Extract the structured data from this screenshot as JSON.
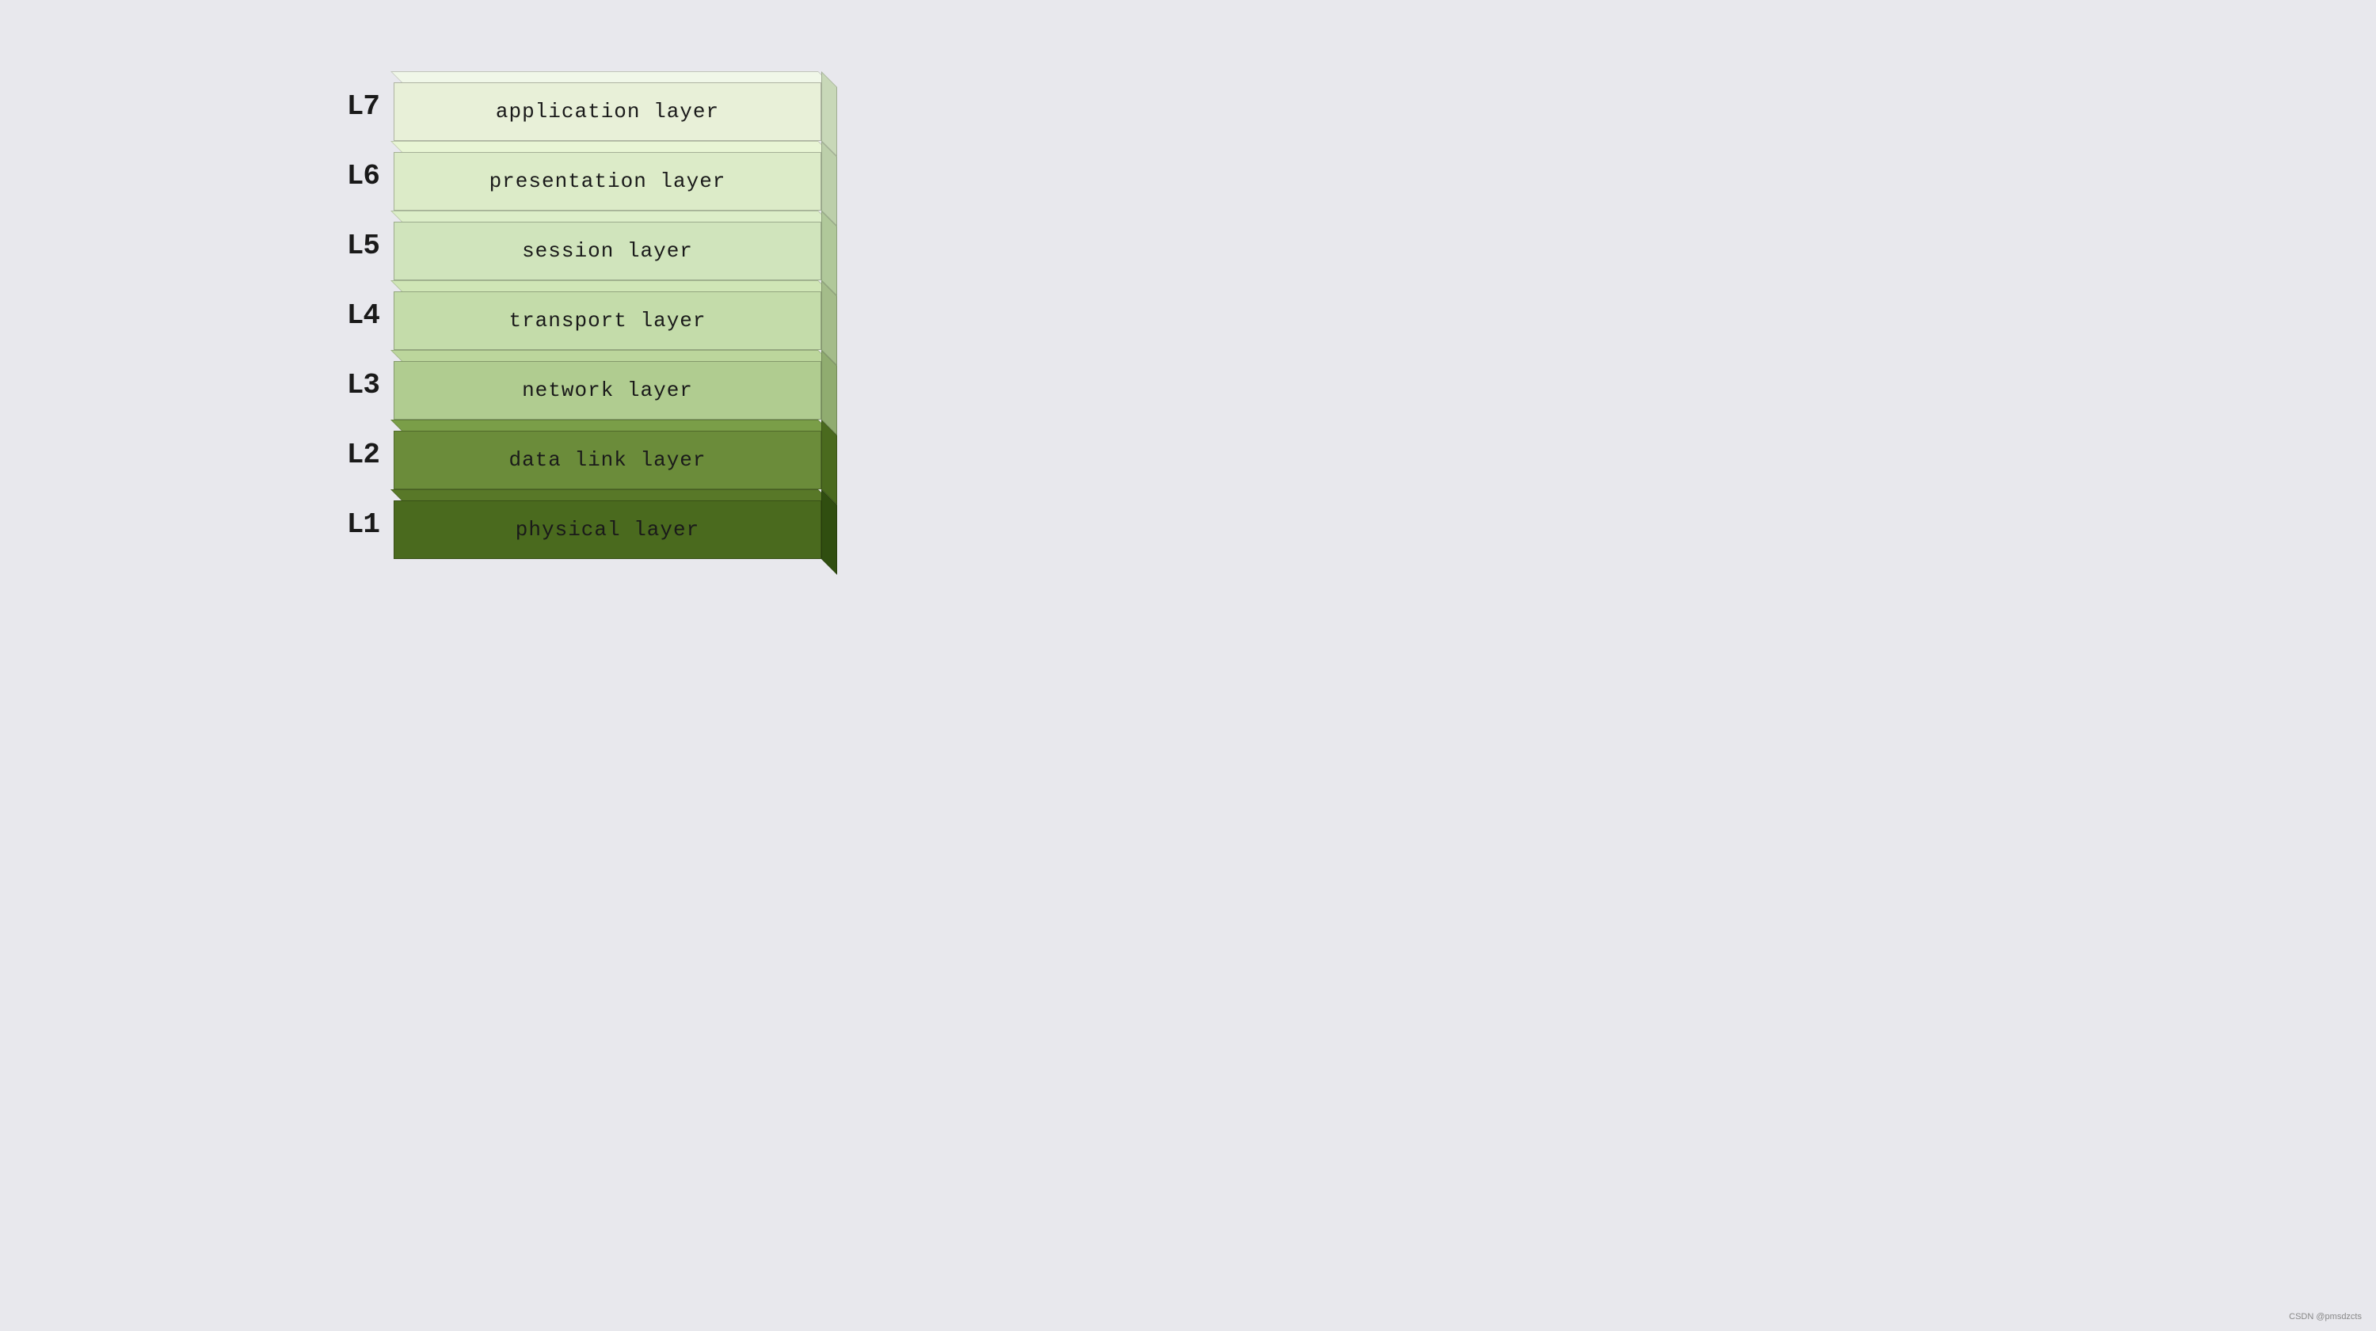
{
  "layers": [
    {
      "id": 7,
      "label": "L7",
      "text": "application layer",
      "class": "layer-7"
    },
    {
      "id": 6,
      "label": "L6",
      "text": "presentation layer",
      "class": "layer-6"
    },
    {
      "id": 5,
      "label": "L5",
      "text": "session layer",
      "class": "layer-5"
    },
    {
      "id": 4,
      "label": "L4",
      "text": "transport layer",
      "class": "layer-4"
    },
    {
      "id": 3,
      "label": "L3",
      "text": "network layer",
      "class": "layer-3"
    },
    {
      "id": 2,
      "label": "L2",
      "text": "data link layer",
      "class": "layer-2"
    },
    {
      "id": 1,
      "label": "L1",
      "text": "physical layer",
      "class": "layer-1"
    }
  ],
  "watermark": "CSDN @pmsdzcts"
}
